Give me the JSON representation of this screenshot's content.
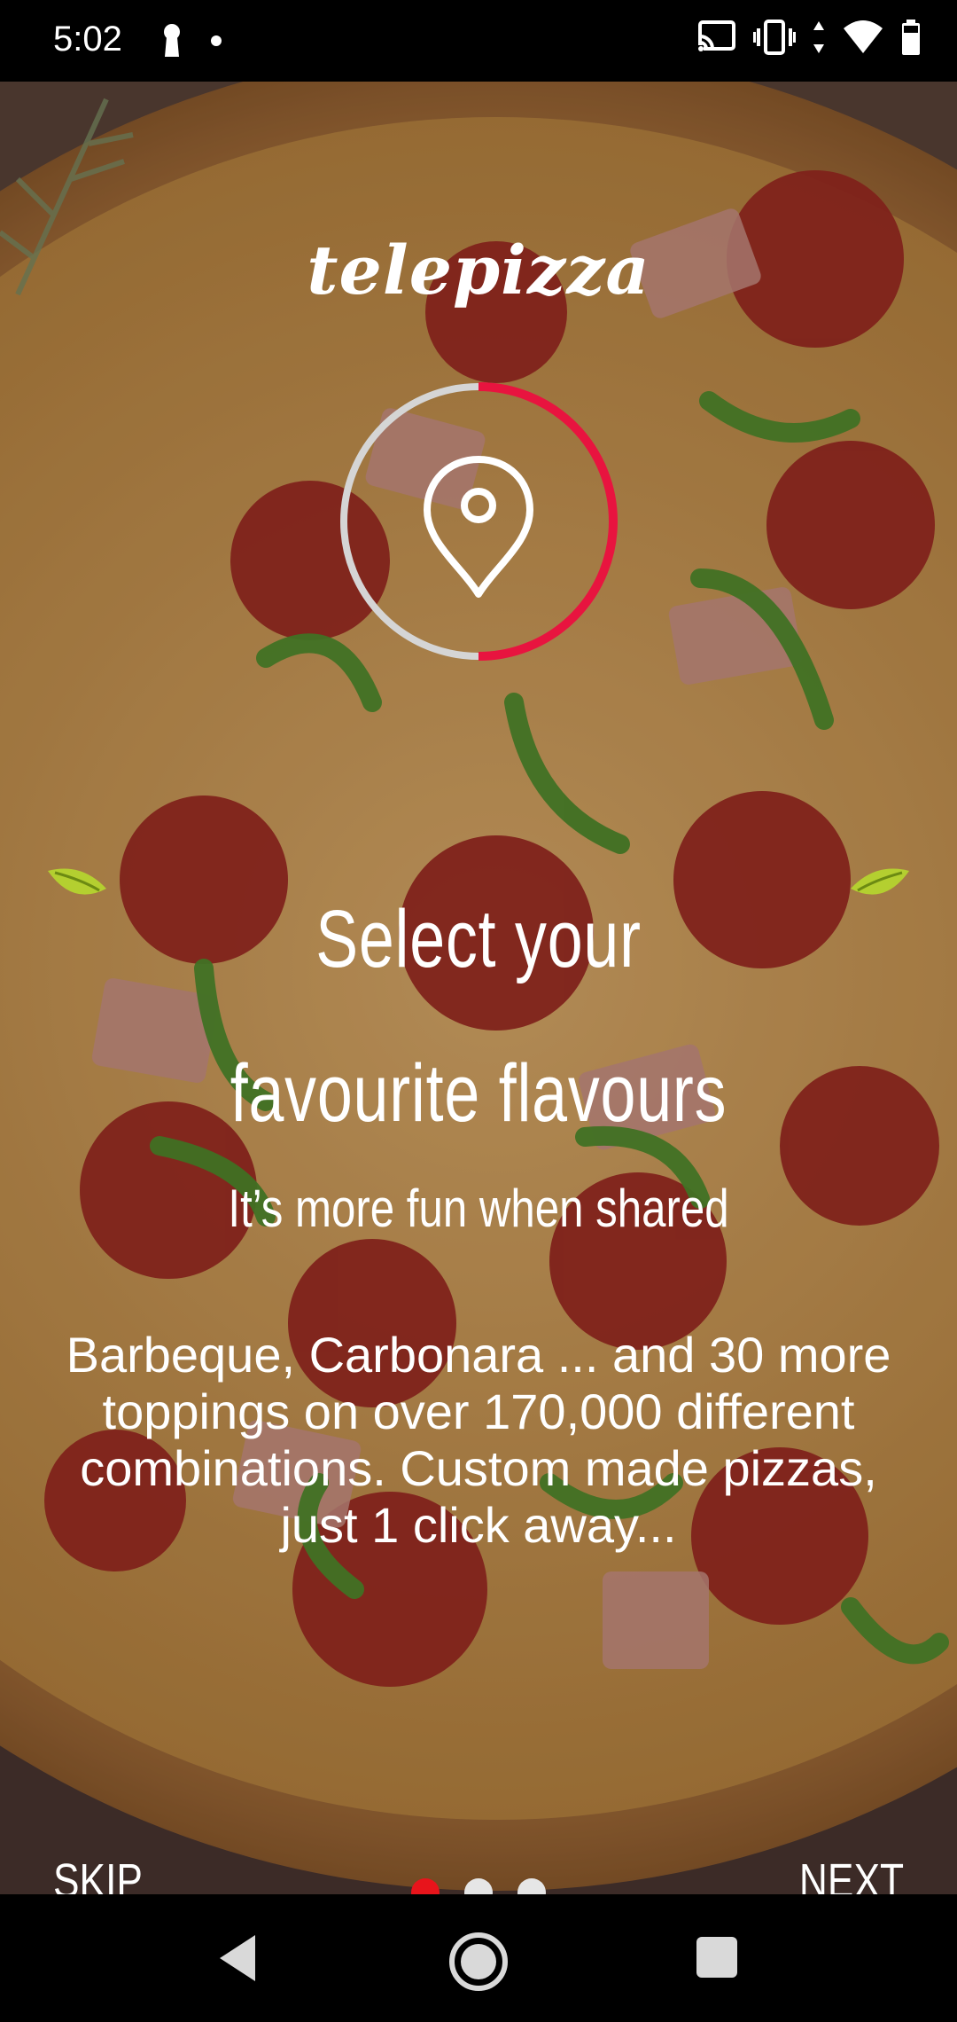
{
  "status_bar": {
    "time": "5:02",
    "icons": [
      "keyhole-icon",
      "dot-icon",
      "cast-icon",
      "vibrate-icon",
      "wifi-icon",
      "battery-icon"
    ]
  },
  "app": {
    "logo_text": "telepizza",
    "accent_color": "#e8141b",
    "feature_icon": "location-pin-icon",
    "progress_fraction": 0.5
  },
  "onboarding": {
    "title": "Select your favourite flavours",
    "subtitle": "It’s more fun when shared",
    "description": "Barbeque, Carbonara ... and 30 more toppings on over 170,000 different combinations. Custom made pizzas, just 1 click away...",
    "skip_label": "SKIP",
    "next_label": "NEXT",
    "page_count": 3,
    "current_page": 1
  },
  "nav_bar": {
    "icons": [
      "back-icon",
      "home-icon",
      "recents-icon"
    ]
  }
}
